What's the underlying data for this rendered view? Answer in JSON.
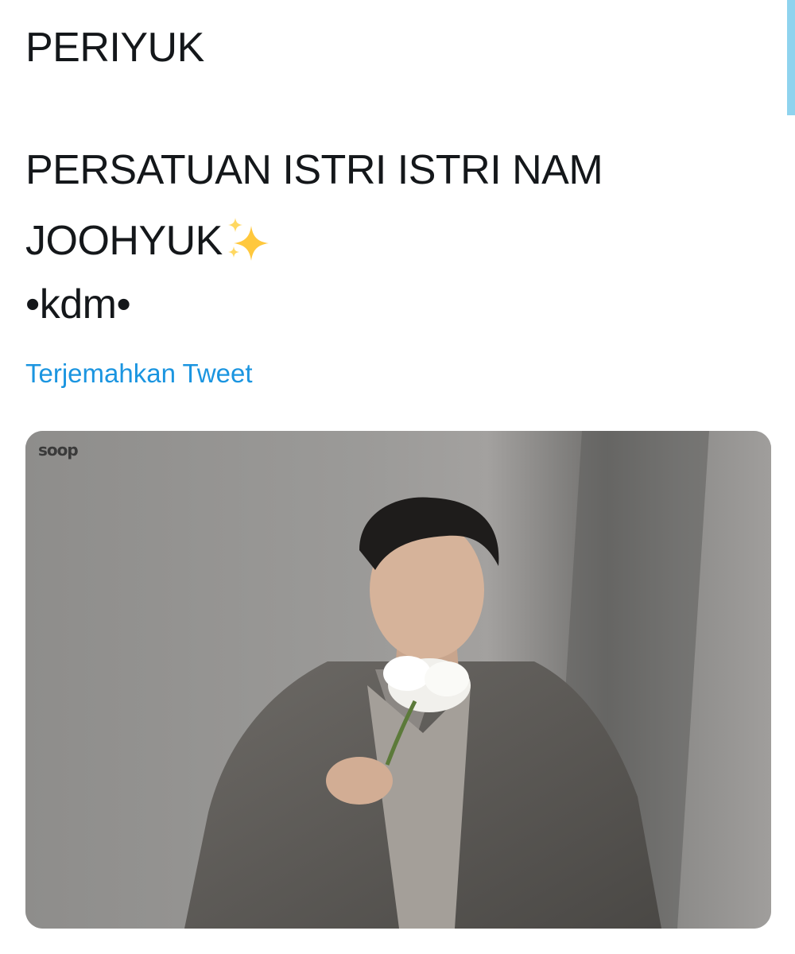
{
  "tweet": {
    "lines": [
      "PERIYUK",
      "PERSATUAN ISTRI ISTRI NAM",
      "JOOHYUK",
      "•kdm•"
    ],
    "emoji": "sparkles-icon",
    "translate_link": "Terjemahkan Tweet"
  },
  "media": {
    "watermark": "soop",
    "alt_subject": "photo"
  },
  "colors": {
    "link": "#1b95e0",
    "text": "#14171a",
    "scrollbar": "#8fd3ee"
  }
}
